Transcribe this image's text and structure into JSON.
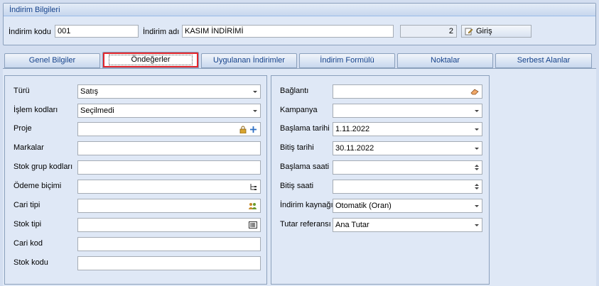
{
  "header": {
    "title": "İndirim Bilgileri",
    "code_label": "İndirim kodu",
    "code_value": "001",
    "name_label": "İndirim adı",
    "name_value": "KASIM İNDİRİMİ",
    "count_value": "2",
    "entry_button_label": "Giriş"
  },
  "tabs": [
    {
      "label": "Genel Bilgiler"
    },
    {
      "label": "Öndeğerler"
    },
    {
      "label": "Uygulanan İndirimler"
    },
    {
      "label": "İndirim Formülü"
    },
    {
      "label": "Noktalar"
    },
    {
      "label": "Serbest Alanlar"
    }
  ],
  "active_tab": "Öndeğerler",
  "left_panel": {
    "fields": [
      {
        "label": "Türü",
        "value": "Satış",
        "icon": "dropdown-arrow"
      },
      {
        "label": "İşlem kodları",
        "value": "Seçilmedi",
        "icon": "dropdown-arrow"
      },
      {
        "label": "Proje",
        "value": "",
        "icon": "lock-plus-icons"
      },
      {
        "label": "Markalar",
        "value": ""
      },
      {
        "label": "Stok grup kodları",
        "value": ""
      },
      {
        "label": "Ödeme biçimi",
        "value": "",
        "icon": "tree-icon"
      },
      {
        "label": "Cari tipi",
        "value": "",
        "icon": "people-icon"
      },
      {
        "label": "Stok tipi",
        "value": "",
        "icon": "barcode-icon"
      },
      {
        "label": "Cari kod",
        "value": ""
      },
      {
        "label": "Stok kodu",
        "value": ""
      }
    ]
  },
  "right_panel": {
    "fields": [
      {
        "label": "Bağlantı",
        "value": "",
        "icon": "eraser-icon"
      },
      {
        "label": "Kampanya",
        "value": "",
        "icon": "dropdown-arrow"
      },
      {
        "label": "Başlama tarihi",
        "value": "1.11.2022",
        "icon": "dropdown-arrow"
      },
      {
        "label": "Bitiş tarihi",
        "value": "30.11.2022",
        "icon": "dropdown-arrow"
      },
      {
        "label": "Başlama saati",
        "value": "",
        "icon": "spin"
      },
      {
        "label": "Bitiş saati",
        "value": "",
        "icon": "spin"
      },
      {
        "label": "İndirim kaynağı",
        "value": "Otomatik (Oran)",
        "icon": "dropdown-arrow"
      },
      {
        "label": "Tutar referansı",
        "value": "Ana Tutar",
        "icon": "dropdown-arrow"
      }
    ]
  }
}
